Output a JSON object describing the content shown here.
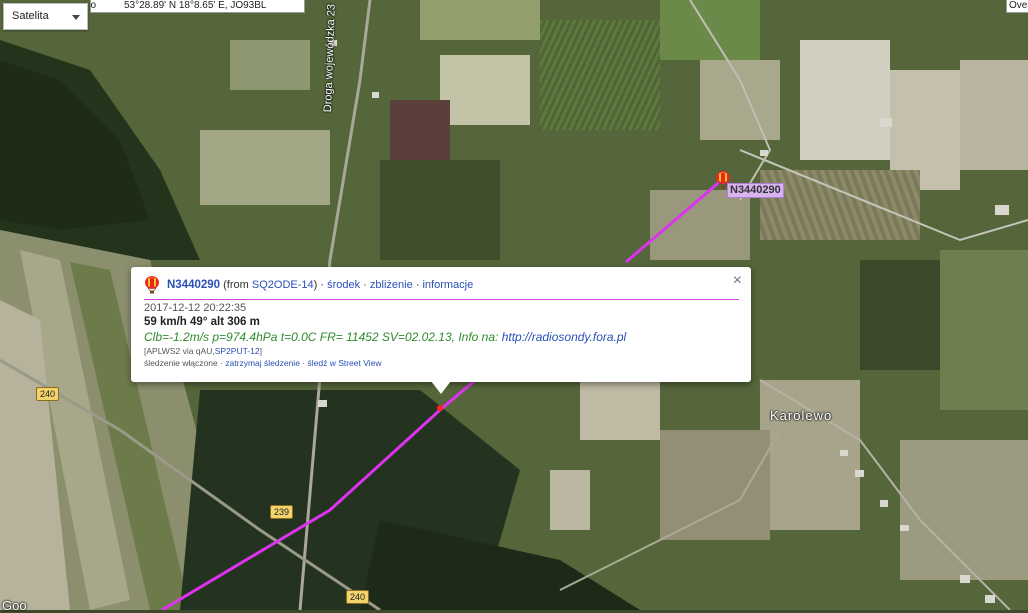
{
  "map": {
    "type_selector": "Satelita",
    "coords_prefix": "po",
    "coords_readout": "53°28.89' N 18°8.65' E, JO93BL",
    "corner_button": "Ove"
  },
  "labels": {
    "road_name": "Droga wojewódzka 23",
    "town": "Karolewo",
    "corner_text": "Goo"
  },
  "road_shields": [
    "240",
    "239",
    "240"
  ],
  "marker": {
    "callsign": "N3440290",
    "icon": "balloon-icon"
  },
  "infowindow": {
    "callsign": "N3440290",
    "from_text": "(from ",
    "from_station": "SQ2ODE-14",
    "from_close": ")",
    "sep": " · ",
    "link_center": "środek",
    "link_zoom": "zbliżenie",
    "link_info": "informacje",
    "timestamp": "2017-12-12 20:22:35",
    "speed_line": "59 km/h 49° alt 306 m",
    "comment_text": "Clb=-1.2m/s p=974.4hPa t=0.0C FR= 11452 SV=02.02.13, Info na: ",
    "comment_link": "http://radiosondy.fora.pl",
    "path_prefix": "[APLWS2 via qAU,",
    "path_link": "SP2PUT-12",
    "path_suffix": "]",
    "tracking_status": "śledzenie włączone",
    "link_stop_tracking": "zatrzymaj śledzenie",
    "link_street_view": "śledź w Street View",
    "close_glyph": "×"
  },
  "colors": {
    "track": "#dd33ee",
    "link": "#2a50b8",
    "comment": "#2f8a2f",
    "marker_label_bg": "#d8b4ef"
  }
}
